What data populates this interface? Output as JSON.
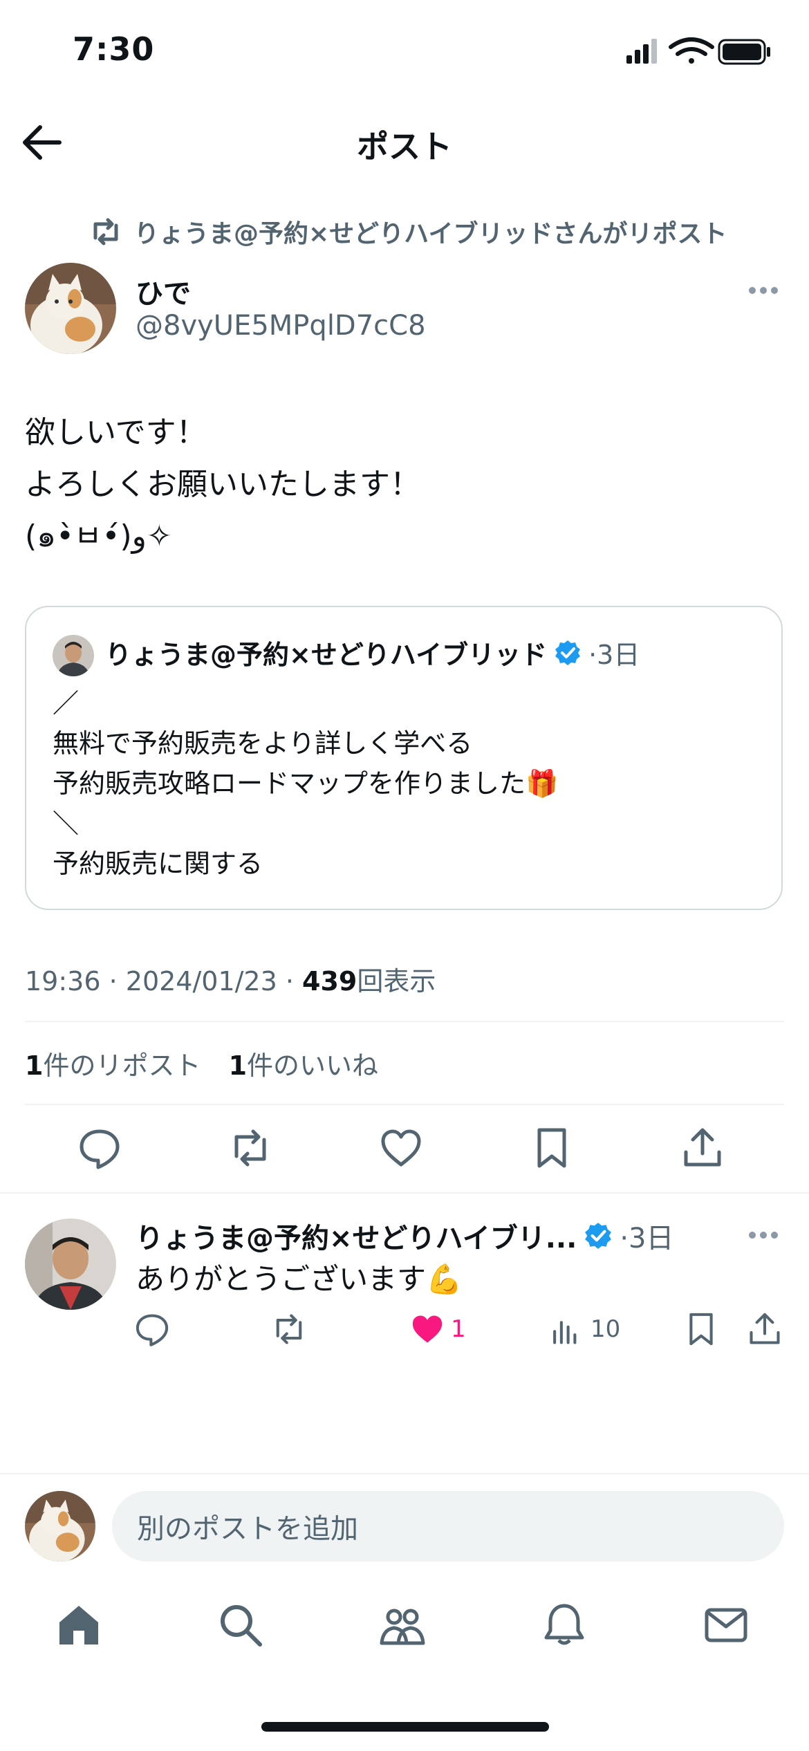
{
  "status_bar": {
    "time": "7:30"
  },
  "header": {
    "title": "ポスト"
  },
  "repost_banner": {
    "text": "りょうま@予約×せどりハイブリッドさんがリポスト"
  },
  "author": {
    "name": "ひで",
    "handle": "@8vyUE5MPqlD7cC8"
  },
  "post": {
    "lines": [
      "欲しいです！",
      "よろしくお願いいたします！",
      "(๑•̀ㅂ•́)و✧"
    ]
  },
  "quote": {
    "name": "りょうま@予約×せどりハイブリッド",
    "time": "·3日",
    "lines": [
      "／",
      "無料で予約販売をより詳しく学べる",
      "予約販売攻略ロードマップを作りました🎁",
      "＼",
      "予約販売に関する"
    ]
  },
  "meta": {
    "time": "19:36",
    "date": "2024/01/23",
    "sep": " · ",
    "views": "439",
    "views_label": "回表示"
  },
  "stats": {
    "reposts": "1",
    "reposts_label": "件のリポスト",
    "likes": "1",
    "likes_label": "件のいいね"
  },
  "reply": {
    "name": "りょうま@予約×せどりハイブリ...",
    "time": "·3日",
    "text": "ありがとうございます💪",
    "likes": "1",
    "views": "10"
  },
  "compose": {
    "placeholder": "別のポストを追加"
  },
  "colors": {
    "accent": "#1d9bf0",
    "like": "#f91880",
    "text": "#0f1419",
    "muted": "#536471"
  }
}
